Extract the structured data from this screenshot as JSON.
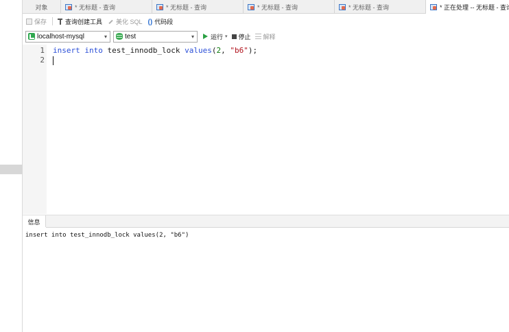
{
  "tabs": [
    {
      "label": "对象"
    },
    {
      "label": "* 无标题 - 查询"
    },
    {
      "label": "* 无标题 - 查询"
    },
    {
      "label": "* 无标题 - 查询"
    },
    {
      "label": "* 无标题 - 查询"
    },
    {
      "label": "* 正在处理 -- 无标题 - 查询"
    }
  ],
  "toolbar": {
    "save_label": "保存",
    "query_builder_label": "查询创建工具",
    "beautify_label": "美化 SQL",
    "snippet_label": "代码段",
    "connection_value": "localhost-mysql",
    "database_value": "test",
    "run_label": "运行",
    "stop_label": "停止",
    "explain_label": "解释"
  },
  "editor": {
    "line_numbers": [
      "1",
      "2"
    ],
    "line1": {
      "kw1": "insert",
      "kw2": "into",
      "table": "test_innodb_lock",
      "kw3": "values",
      "open": "(",
      "num": "2",
      "comma": ", ",
      "str": "\"b6\"",
      "close": ");"
    }
  },
  "results": {
    "tab_label": "信息",
    "message": "insert into test_innodb_lock values(2, \"b6\")"
  },
  "colors": {
    "keyword": "#2b4fd8",
    "string": "#b0101a",
    "number": "#0c7a0c",
    "run_green": "#2aa043"
  }
}
